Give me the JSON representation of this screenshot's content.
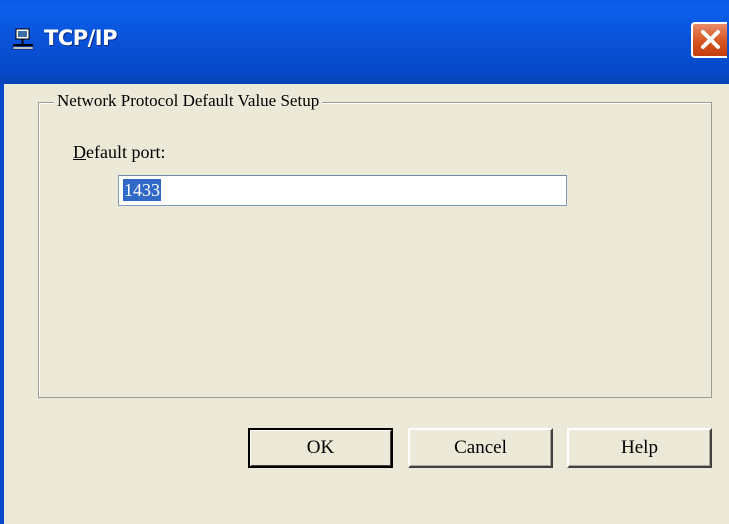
{
  "window": {
    "title": "TCP/IP",
    "title_icon": "network-icon",
    "close_icon": "close-icon",
    "colors": {
      "titlebar": "#0a53d9",
      "close": "#d6541f",
      "face": "#ece9d8",
      "selection": "#3169c6"
    }
  },
  "group": {
    "legend": "Network Protocol Default Value Setup"
  },
  "port_field": {
    "label_mnemonic": "D",
    "label_rest": "efault port:",
    "value": "1433"
  },
  "buttons": {
    "ok": "OK",
    "cancel": "Cancel",
    "help": "Help"
  }
}
